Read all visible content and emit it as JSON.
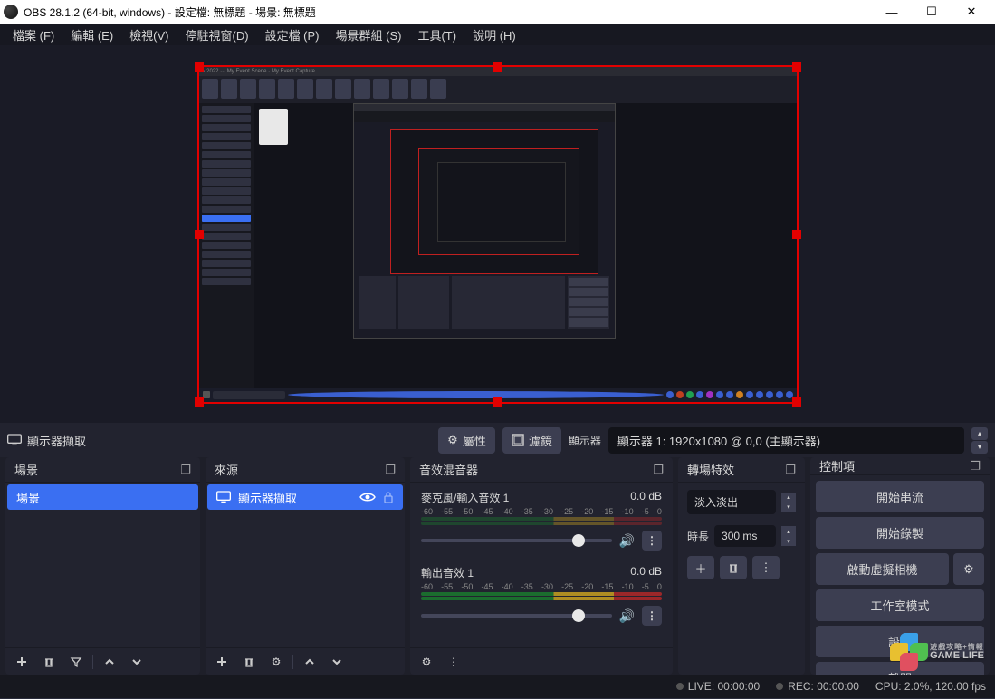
{
  "window": {
    "title": "OBS 28.1.2 (64-bit, windows) - 設定檔: 無標題 - 場景: 無標題",
    "minimize": "—",
    "maximize": "☐",
    "close": "✕"
  },
  "menu": {
    "file": "檔案 (F)",
    "edit": "編輯 (E)",
    "view": "檢視(V)",
    "dock": "停駐視窗(D)",
    "profile": "設定檔 (P)",
    "scene_collection": "場景群組 (S)",
    "tools": "工具(T)",
    "help": "說明 (H)"
  },
  "source_toolbar": {
    "source_name": "顯示器擷取",
    "properties_btn": "屬性",
    "filters_btn": "濾鏡",
    "display_label": "顯示器",
    "display_value": "顯示器 1: 1920x1080 @ 0,0 (主顯示器)"
  },
  "docks": {
    "scenes": {
      "title": "場景",
      "items": [
        "場景"
      ]
    },
    "sources": {
      "title": "來源",
      "items": [
        {
          "name": "顯示器擷取",
          "visible": true,
          "locked": false
        }
      ]
    },
    "mixer": {
      "title": "音效混音器",
      "channels": [
        {
          "name": "麥克風/輸入音效 1",
          "db": "0.0 dB",
          "ticks": [
            "-60",
            "-55",
            "-50",
            "-45",
            "-40",
            "-35",
            "-30",
            "-25",
            "-20",
            "-15",
            "-10",
            "-5",
            "0"
          ]
        },
        {
          "name": "輸出音效 1",
          "db": "0.0 dB",
          "ticks": [
            "-60",
            "-55",
            "-50",
            "-45",
            "-40",
            "-35",
            "-30",
            "-25",
            "-20",
            "-15",
            "-10",
            "-5",
            "0"
          ]
        }
      ]
    },
    "transitions": {
      "title": "轉場特效",
      "mode": "淡入淡出",
      "duration_label": "時長",
      "duration": "300 ms"
    },
    "controls": {
      "title": "控制項",
      "start_stream": "開始串流",
      "start_record": "開始錄製",
      "virtual_cam": "啟動虛擬相機",
      "studio_mode": "工作室模式",
      "settings": "設定",
      "exit": "離開"
    }
  },
  "statusbar": {
    "live": "LIVE: 00:00:00",
    "rec": "REC: 00:00:00",
    "cpu": "CPU: 2.0%, 120.00 fps"
  },
  "watermark": {
    "line1": "遊戲攻略+情報",
    "line2": "GAME LIFE"
  }
}
